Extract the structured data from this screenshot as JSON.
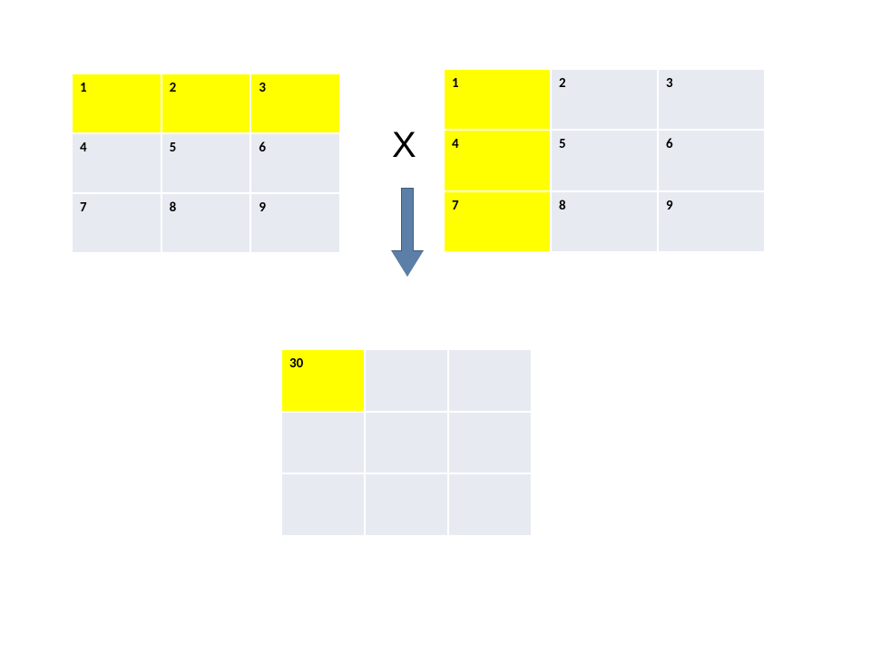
{
  "operator": "X",
  "matrixLeft": {
    "highlights": [
      0,
      1,
      2
    ],
    "cells": [
      "1",
      "2",
      "3",
      "4",
      "5",
      "6",
      "7",
      "8",
      "9"
    ]
  },
  "matrixRight": {
    "highlights": [
      0,
      3,
      6
    ],
    "cells": [
      "1",
      "2",
      "3",
      "4",
      "5",
      "6",
      "7",
      "8",
      "9"
    ]
  },
  "matrixResult": {
    "highlights": [
      0
    ],
    "cells": [
      "30",
      "",
      "",
      "",
      "",
      "",
      "",
      "",
      ""
    ]
  },
  "colors": {
    "highlight": "#ffff00",
    "cellBg": "#e7ebf1",
    "arrowFill": "#5b7fa6",
    "arrowBorder": "#3e5c7a"
  }
}
